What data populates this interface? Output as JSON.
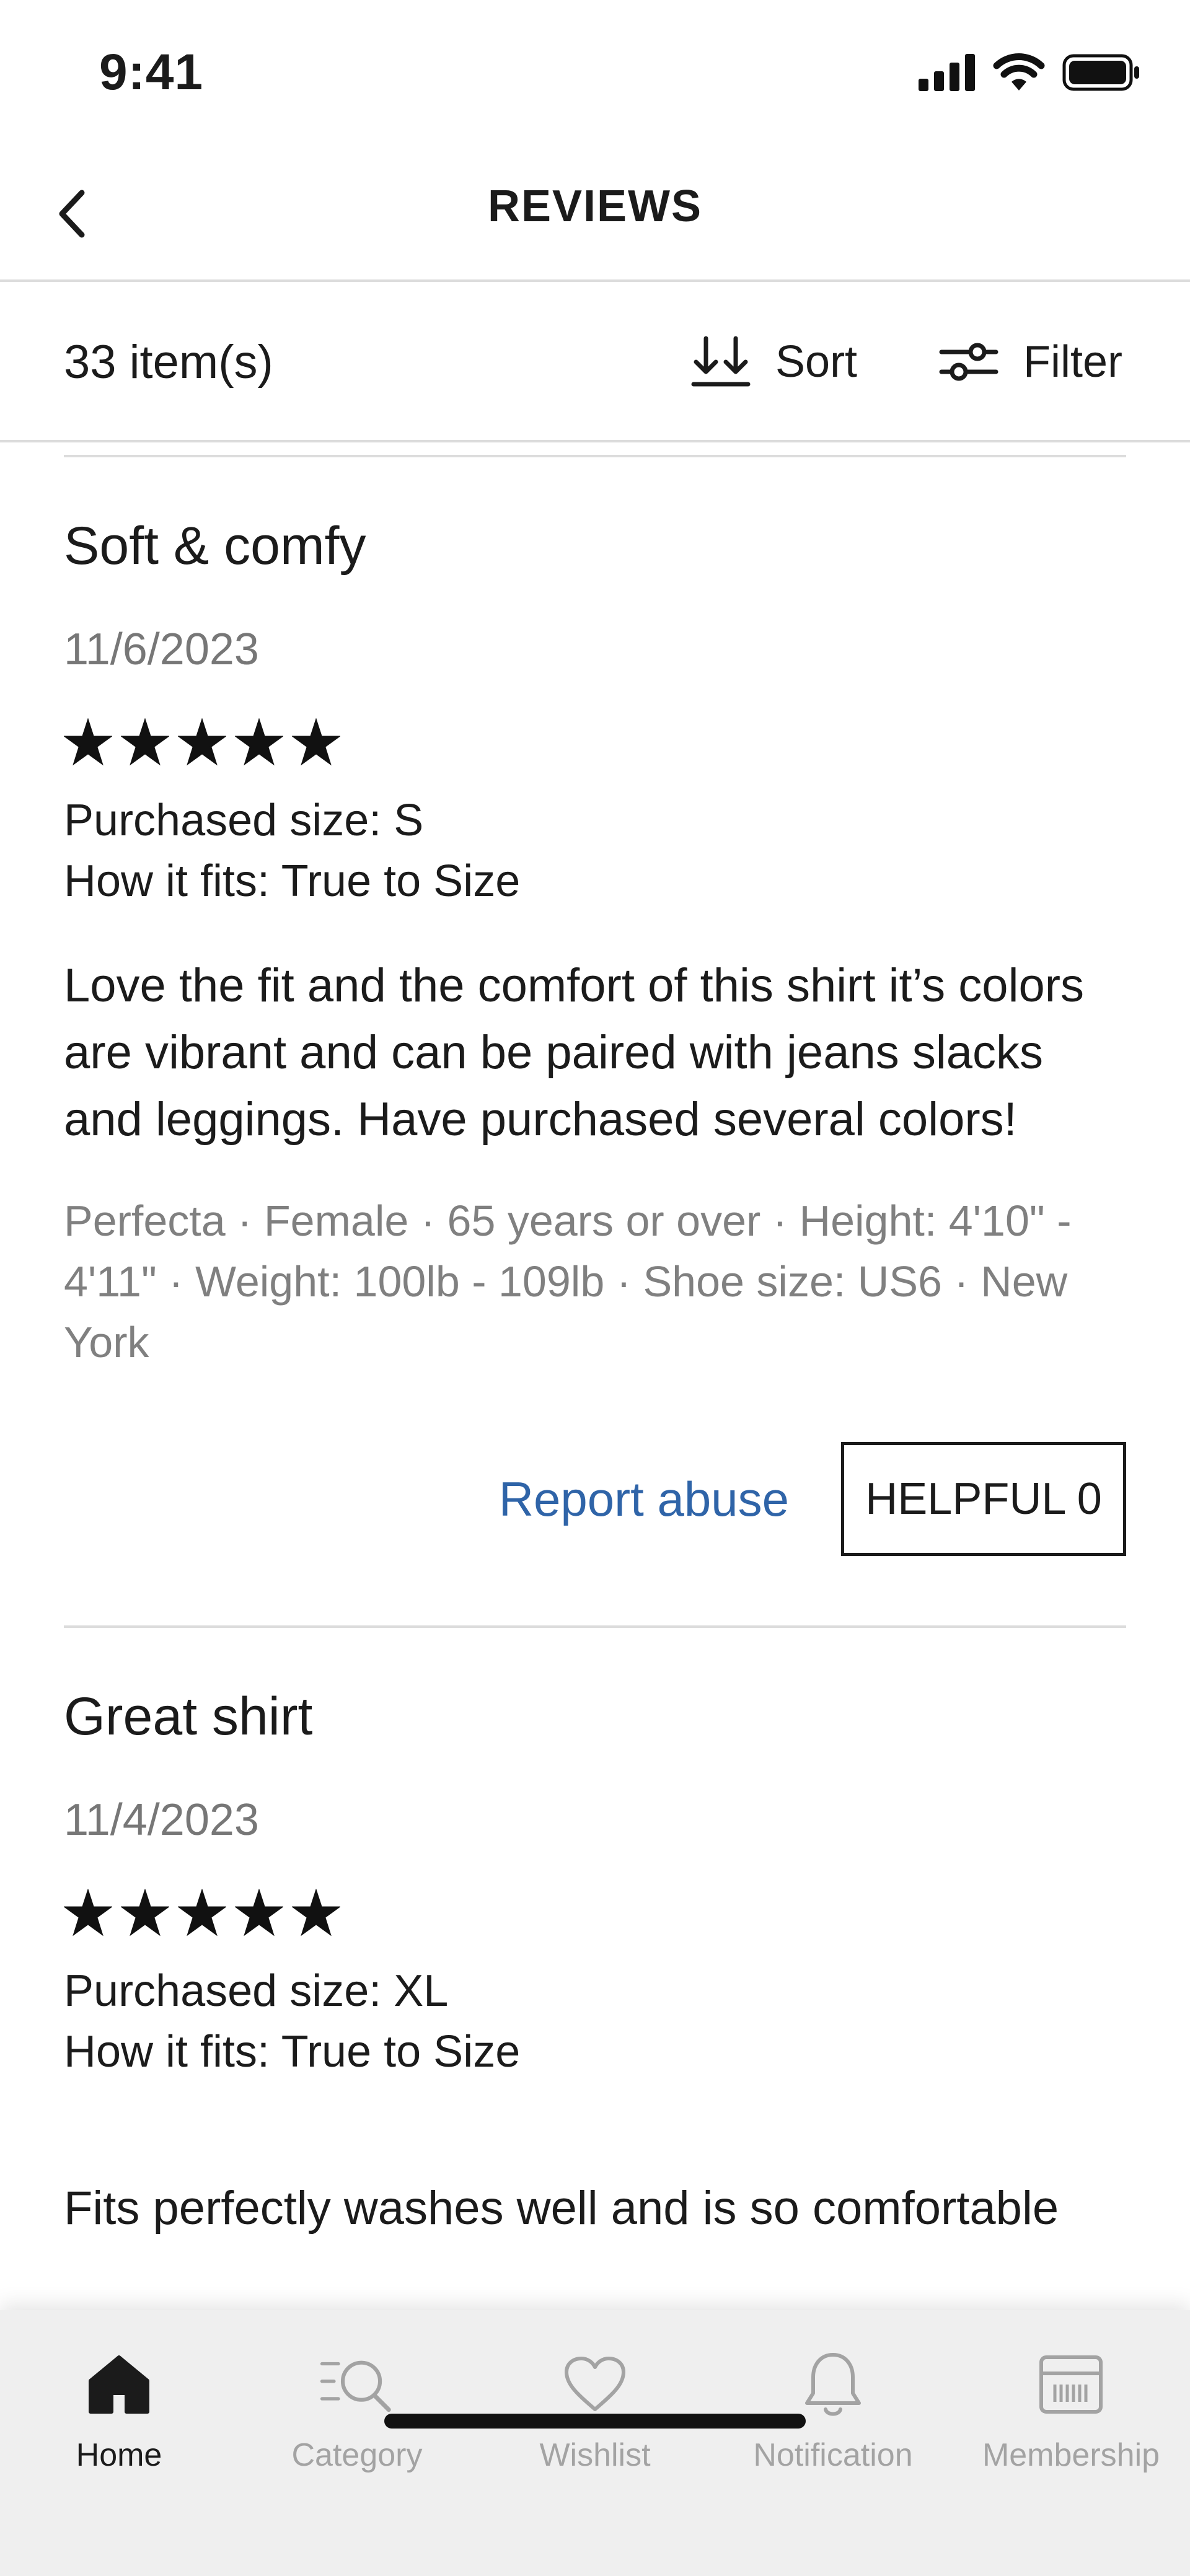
{
  "status_bar": {
    "time": "9:41"
  },
  "header": {
    "title": "REVIEWS"
  },
  "toolbar": {
    "count": "33 item(s)",
    "sort_label": "Sort",
    "filter_label": "Filter"
  },
  "reviews": [
    {
      "title": "Soft & comfy",
      "date": "11/6/2023",
      "rating": 5,
      "purchased_size": "Purchased size: S",
      "fit": "How it fits: True to Size",
      "body": "Love the fit and the comfort of this shirt it’s colors are vibrant and can be paired with jeans slacks and leggings. Have purchased several colors!",
      "reviewer": "Perfecta · Female · 65 years or over · Height: 4'10\" - 4'11\" · Weight: 100lb - 109lb · Shoe size: US6 · New York",
      "report_label": "Report abuse",
      "helpful_label": "HELPFUL 0"
    },
    {
      "title": "Great shirt",
      "date": "11/4/2023",
      "rating": 5,
      "purchased_size": "Purchased size: XL",
      "fit": "How it fits: True to Size",
      "body": "Fits perfectly washes well and is so comfortable"
    }
  ],
  "bottom_nav": {
    "items": [
      {
        "label": "Home",
        "icon": "home-icon",
        "active": true
      },
      {
        "label": "Category",
        "icon": "category-search-icon",
        "active": false
      },
      {
        "label": "Wishlist",
        "icon": "heart-icon",
        "active": false
      },
      {
        "label": "Notification",
        "icon": "bell-icon",
        "active": false
      },
      {
        "label": "Membership",
        "icon": "membership-card-icon",
        "active": false
      }
    ]
  },
  "colors": {
    "link": "#2f64a8",
    "muted": "#808080",
    "inactive_nav": "#a3a3a3",
    "nav_bg": "#efefef"
  }
}
